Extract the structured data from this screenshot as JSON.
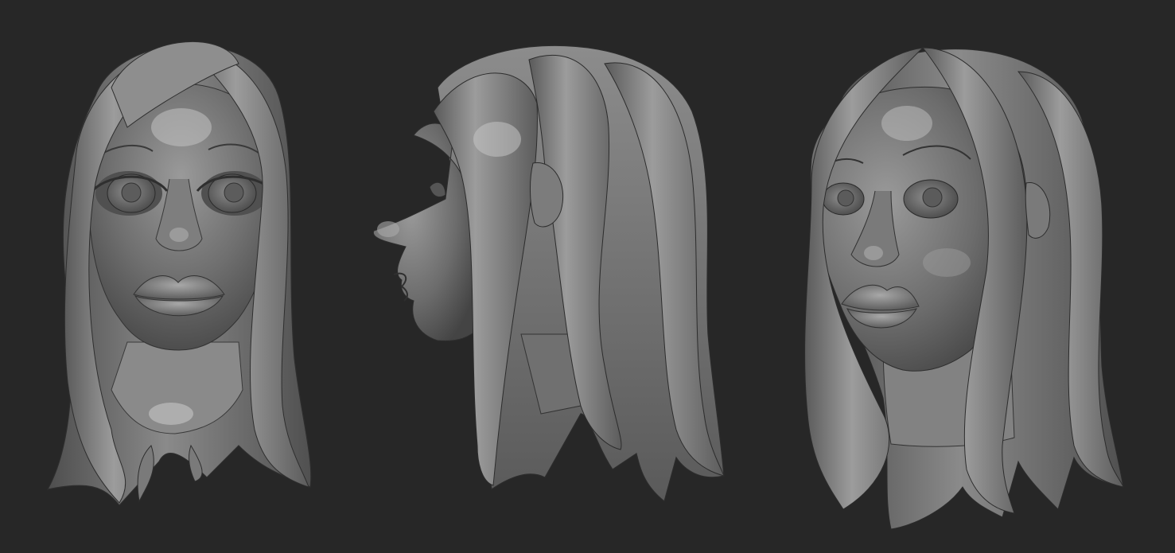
{
  "scene": {
    "background": "#272727",
    "clay_base": "#6e6e6e",
    "clay_highlight": "#b4b4b4",
    "clay_shadow": "#3c3c3c",
    "views": [
      {
        "id": "front",
        "label": "front-view"
      },
      {
        "id": "side",
        "label": "profile-view"
      },
      {
        "id": "three-quarter",
        "label": "three-quarter-view"
      }
    ]
  }
}
